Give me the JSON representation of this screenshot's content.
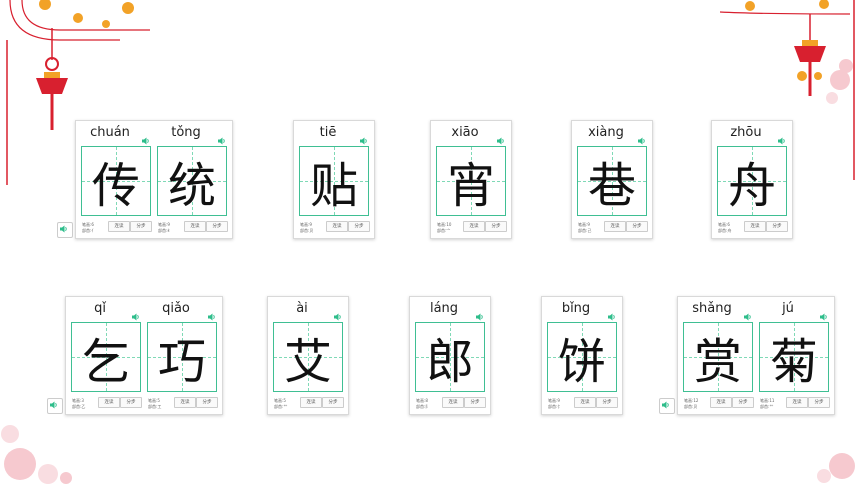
{
  "colors": {
    "grid": "#3fbf93",
    "speaker": "#2ebd8b",
    "lantern": "#d8202f",
    "gold": "#f2a227",
    "blossom": "#f6c9cf"
  },
  "icons": {
    "speaker": "speaker-icon",
    "play": "play-audio-icon"
  },
  "labels": {
    "stroke_count": "笔画:",
    "radical": "部首:",
    "write": "连读",
    "step": "分步"
  },
  "row1": [
    {
      "chars": [
        {
          "pinyin": "chuán",
          "hanzi": "传",
          "strokes": "6",
          "radical": "亻"
        },
        {
          "pinyin": "tǒng",
          "hanzi": "统",
          "strokes": "9",
          "radical": "纟"
        }
      ]
    },
    {
      "chars": [
        {
          "pinyin": "tiē",
          "hanzi": "贴",
          "strokes": "9",
          "radical": "贝"
        }
      ]
    },
    {
      "chars": [
        {
          "pinyin": "xiāo",
          "hanzi": "宵",
          "strokes": "10",
          "radical": "宀"
        }
      ]
    },
    {
      "chars": [
        {
          "pinyin": "xiàng",
          "hanzi": "巷",
          "strokes": "9",
          "radical": "己"
        }
      ]
    },
    {
      "chars": [
        {
          "pinyin": "zhōu",
          "hanzi": "舟",
          "strokes": "6",
          "radical": "舟"
        }
      ]
    }
  ],
  "row2": [
    {
      "chars": [
        {
          "pinyin": "qǐ",
          "hanzi": "乞",
          "strokes": "3",
          "radical": "乙"
        },
        {
          "pinyin": "qiǎo",
          "hanzi": "巧",
          "strokes": "5",
          "radical": "工"
        }
      ]
    },
    {
      "chars": [
        {
          "pinyin": "ài",
          "hanzi": "艾",
          "strokes": "5",
          "radical": "艹"
        }
      ]
    },
    {
      "chars": [
        {
          "pinyin": "láng",
          "hanzi": "郎",
          "strokes": "8",
          "radical": "阝"
        }
      ]
    },
    {
      "chars": [
        {
          "pinyin": "bǐng",
          "hanzi": "饼",
          "strokes": "9",
          "radical": "饣"
        }
      ]
    },
    {
      "chars": [
        {
          "pinyin": "shǎng",
          "hanzi": "赏",
          "strokes": "12",
          "radical": "贝"
        },
        {
          "pinyin": "jú",
          "hanzi": "菊",
          "strokes": "11",
          "radical": "艹"
        }
      ]
    }
  ]
}
